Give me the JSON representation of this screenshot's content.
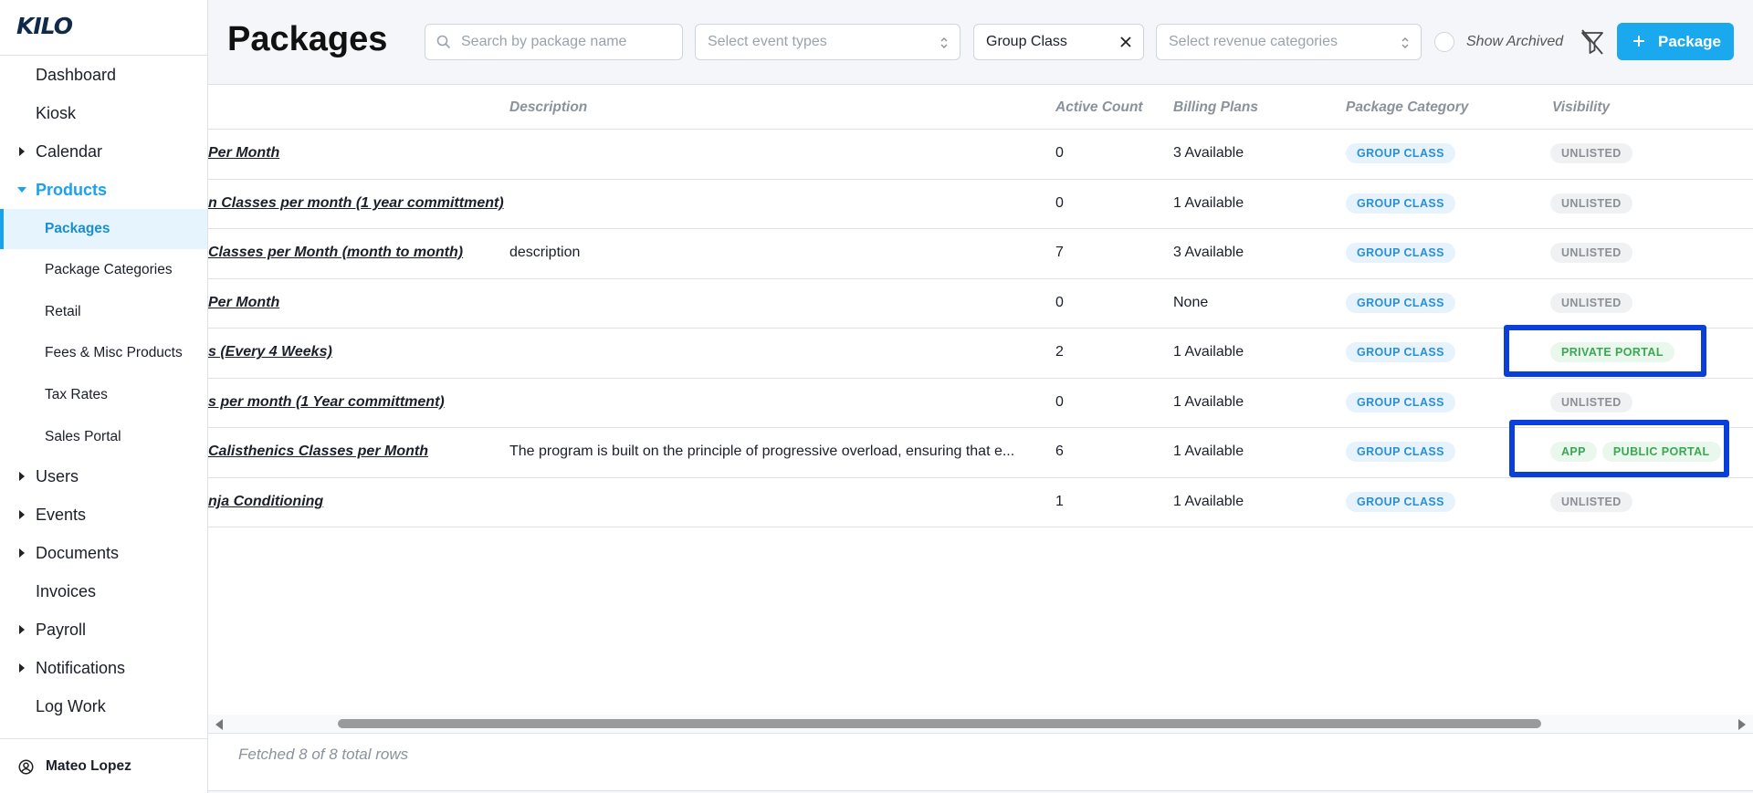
{
  "app": {
    "logo": "KILO"
  },
  "sidebar": {
    "items": [
      {
        "label": "Dashboard"
      },
      {
        "label": "Kiosk"
      },
      {
        "label": "Calendar"
      },
      {
        "label": "Products"
      },
      {
        "label": "Users"
      },
      {
        "label": "Events"
      },
      {
        "label": "Documents"
      },
      {
        "label": "Invoices"
      },
      {
        "label": "Payroll"
      },
      {
        "label": "Notifications"
      },
      {
        "label": "Log Work"
      }
    ],
    "products_sub": [
      {
        "label": "Packages"
      },
      {
        "label": "Package Categories"
      },
      {
        "label": "Retail"
      },
      {
        "label": "Fees & Misc Products"
      },
      {
        "label": "Tax Rates"
      },
      {
        "label": "Sales Portal"
      }
    ],
    "user": {
      "name": "Mateo Lopez"
    }
  },
  "header": {
    "title": "Packages",
    "search_placeholder": "Search by package name",
    "event_types_placeholder": "Select event types",
    "category_filter_value": "Group Class",
    "revenue_placeholder": "Select revenue categories",
    "show_archived_label": "Show Archived",
    "add_button_label": "Package"
  },
  "table": {
    "columns": {
      "description": "Description",
      "active_count": "Active Count",
      "billing_plans": "Billing Plans",
      "package_category": "Package Category",
      "visibility": "Visibility"
    },
    "rows": [
      {
        "name": "Per Month",
        "description": "",
        "active_count": "0",
        "billing_plans": "3 Available",
        "category": "GROUP CLASS",
        "visibility": [
          "UNLISTED"
        ]
      },
      {
        "name": "n Classes per month (1 year committment)",
        "description": "",
        "active_count": "0",
        "billing_plans": "1 Available",
        "category": "GROUP CLASS",
        "visibility": [
          "UNLISTED"
        ]
      },
      {
        "name": "Classes per Month (month to month)",
        "description": "description",
        "active_count": "7",
        "billing_plans": "3 Available",
        "category": "GROUP CLASS",
        "visibility": [
          "UNLISTED"
        ]
      },
      {
        "name": "Per Month",
        "description": "",
        "active_count": "0",
        "billing_plans": "None",
        "category": "GROUP CLASS",
        "visibility": [
          "UNLISTED"
        ]
      },
      {
        "name": "s (Every 4 Weeks)",
        "description": "",
        "active_count": "2",
        "billing_plans": "1 Available",
        "category": "GROUP CLASS",
        "visibility": [
          "PRIVATE PORTAL"
        ]
      },
      {
        "name": "s per month (1 Year committment)",
        "description": "",
        "active_count": "0",
        "billing_plans": "1 Available",
        "category": "GROUP CLASS",
        "visibility": [
          "UNLISTED"
        ]
      },
      {
        "name": "Calisthenics Classes per Month",
        "description": "The program is built on the principle of progressive overload, ensuring that e...",
        "active_count": "6",
        "billing_plans": "1 Available",
        "category": "GROUP CLASS",
        "visibility": [
          "APP",
          "PUBLIC PORTAL"
        ]
      },
      {
        "name": "nja Conditioning",
        "description": "",
        "active_count": "1",
        "billing_plans": "1 Available",
        "category": "GROUP CLASS",
        "visibility": [
          "UNLISTED"
        ]
      }
    ],
    "footer": "Fetched 8 of 8 total rows"
  },
  "colors": {
    "accent": "#1aa9ee",
    "highlight_box": "#0a3fd9",
    "category_badge_bg": "#e6f3fc",
    "green_badge_text": "#3aa853"
  }
}
